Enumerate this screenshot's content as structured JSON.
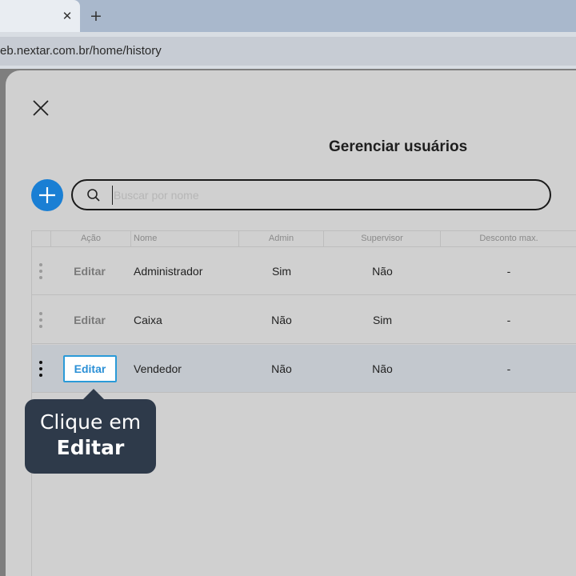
{
  "browser": {
    "new_tab_symbol": "+",
    "close_tab_symbol": "✕",
    "url": "eb.nextar.com.br/home/history"
  },
  "modal": {
    "title": "Gerenciar usuários",
    "search_placeholder": "Buscar por nome",
    "search_value": "",
    "columns": [
      "Ação",
      "Nome",
      "Admin",
      "Supervisor",
      "Desconto max."
    ],
    "rows": [
      {
        "action": "Editar",
        "name": "Administrador",
        "admin": "Sim",
        "supervisor": "Não",
        "discount": "-"
      },
      {
        "action": "Editar",
        "name": "Caixa",
        "admin": "Não",
        "supervisor": "Sim",
        "discount": "-"
      },
      {
        "action": "Editar",
        "name": "Vendedor",
        "admin": "Não",
        "supervisor": "Não",
        "discount": "-"
      }
    ],
    "selected_row": 2
  },
  "tooltip": {
    "line1": "Clique em",
    "line2": "Editar"
  },
  "colors": {
    "accent": "#1a7fd4",
    "edit_border": "#2a9ad8",
    "tooltip_bg": "#2e3a4a",
    "selected_row": "#c3c8ce"
  },
  "icons": [
    "close-icon",
    "plus-icon",
    "search-icon",
    "drag-handle-icon"
  ]
}
